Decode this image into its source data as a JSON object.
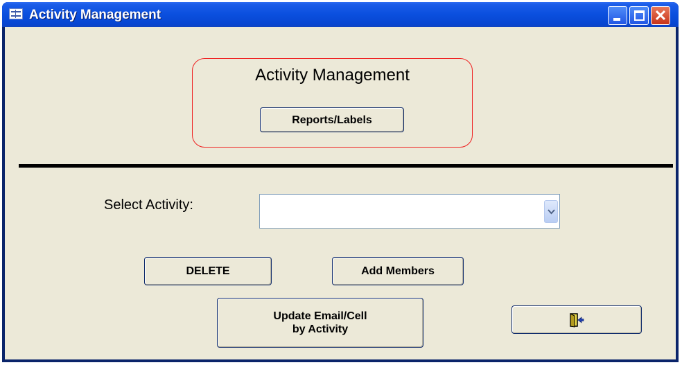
{
  "window": {
    "title": "Activity Management",
    "controls": {
      "minimize": "minimize",
      "maximize": "maximize",
      "close": "✕"
    }
  },
  "header": {
    "title": "Activity Management",
    "reports_button": "Reports/Labels"
  },
  "form": {
    "select_label": "Select Activity:",
    "select_value": ""
  },
  "actions": {
    "delete_button": "DELETE",
    "add_members_button": "Add Members",
    "update_email_line1": "Update Email/Cell",
    "update_email_line2": "by Activity",
    "exit_icon": "exit-door-icon"
  },
  "colors": {
    "titlebar": "#0a4fde",
    "client_bg": "#ece9d8",
    "header_border": "#ef1f1f",
    "divider": "#000000"
  }
}
